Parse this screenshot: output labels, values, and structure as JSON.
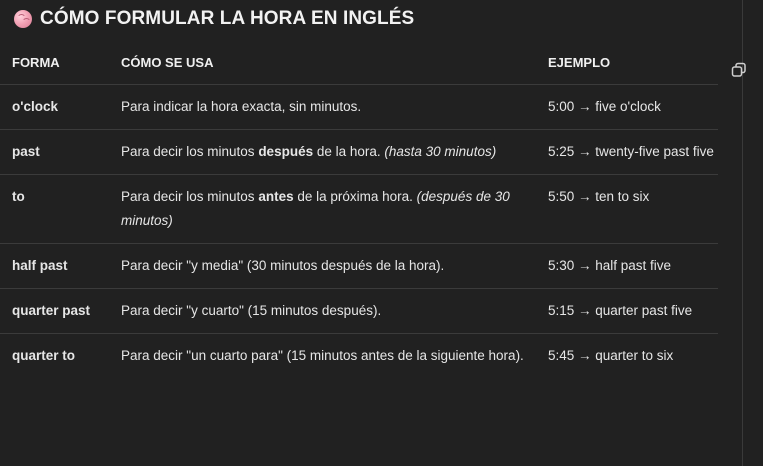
{
  "title": "CÓMO FORMULAR LA HORA EN INGLÉS",
  "icons": {
    "title_icon": "brain-icon",
    "copy": "copy-icon"
  },
  "table": {
    "headers": [
      "FORMA",
      "CÓMO SE USA",
      "EJEMPLO"
    ],
    "rows": [
      {
        "form": "o'clock",
        "usage": {
          "before": "Para indicar la hora exacta, sin minutos.",
          "bold": "",
          "after": "",
          "italic": ""
        },
        "example": "5:00 → five o'clock"
      },
      {
        "form": "past",
        "usage": {
          "before": "Para decir los minutos ",
          "bold": "después",
          "after": " de la hora. ",
          "italic": "(hasta 30 minutos)"
        },
        "example": "5:25 → twenty-five past five"
      },
      {
        "form": "to",
        "usage": {
          "before": "Para decir los minutos ",
          "bold": "antes",
          "after": " de la próxima hora. ",
          "italic": "(después de 30 minutos)"
        },
        "example": "5:50 → ten to six"
      },
      {
        "form": "half past",
        "usage": {
          "before": "Para decir \"y media\" (30 minutos después de la hora).",
          "bold": "",
          "after": "",
          "italic": ""
        },
        "example": "5:30 → half past five"
      },
      {
        "form": "quarter past",
        "usage": {
          "before": "Para decir \"y cuarto\" (15 minutos después).",
          "bold": "",
          "after": "",
          "italic": ""
        },
        "example": "5:15 → quarter past five"
      },
      {
        "form": "quarter to",
        "usage": {
          "before": "Para decir \"un cuarto para\" (15 minutos antes de la siguiente hora).",
          "bold": "",
          "after": "",
          "italic": ""
        },
        "example": "5:45 → quarter to six"
      }
    ]
  }
}
